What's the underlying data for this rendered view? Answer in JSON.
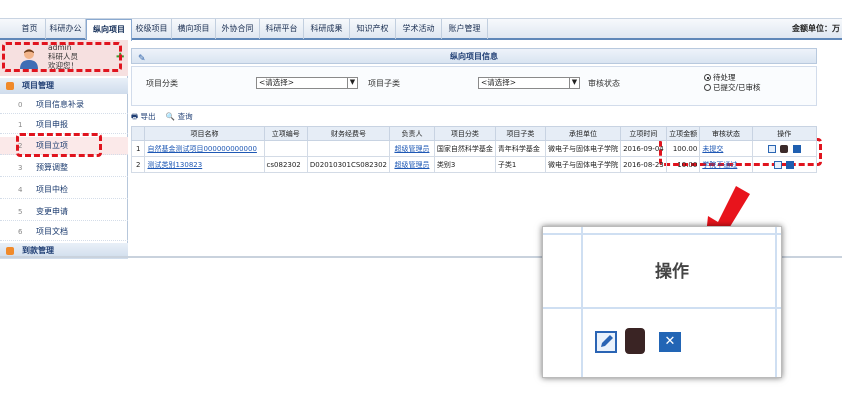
{
  "topnav": {
    "tabs": [
      "首页",
      "科研办公",
      "纵向项目",
      "校级项目",
      "横向项目",
      "外协合同",
      "科研平台",
      "科研成果",
      "知识产权",
      "学术活动",
      "账户管理"
    ],
    "active_index": 2,
    "unit_label": "金额单位：万"
  },
  "user": {
    "name": "admin",
    "role": "科研人员",
    "welcome": "欢迎您！"
  },
  "sidebar": {
    "section1": "项目管理",
    "items": [
      {
        "num": "0",
        "label": "项目信息补录"
      },
      {
        "num": "1",
        "label": "项目申报"
      },
      {
        "num": "2",
        "label": "项目立项"
      },
      {
        "num": "3",
        "label": "预算调整"
      },
      {
        "num": "4",
        "label": "项目中检"
      },
      {
        "num": "5",
        "label": "变更申请"
      },
      {
        "num": "6",
        "label": "项目文档"
      }
    ],
    "section2": "到款管理"
  },
  "panel": {
    "title": "纵向项目信息"
  },
  "filter": {
    "category_label": "项目分类",
    "category_value": "<请选择>",
    "subcategory_label": "项目子类",
    "subcategory_value": "<请选择>",
    "status_label": "审核状态",
    "status_options": [
      "待处理",
      "已提交/已审核"
    ],
    "status_selected": "待处理"
  },
  "toolbar": {
    "export_label": "导出",
    "query_label": "查询"
  },
  "table": {
    "headers": [
      "",
      "项目名称",
      "立项编号",
      "财务经费号",
      "负责人",
      "项目分类",
      "项目子类",
      "承担单位",
      "立项时间",
      "立项金额",
      "审核状态",
      "操作"
    ],
    "rows": [
      {
        "idx": "1",
        "name": "自然基金测试项目000000000000",
        "code": "",
        "finance_no": "",
        "leader": "超级管理员",
        "category": "国家自然科学基金",
        "subcategory": "青年科学基金",
        "unit": "微电子与固体电子学院",
        "date": "2016-09-04",
        "amount": "100.00",
        "status": "未提交"
      },
      {
        "idx": "2",
        "name": "测试类别130823",
        "code": "cs082302",
        "finance_no": "D02010301CS082302",
        "leader": "超级管理员",
        "category": "类别3",
        "subcategory": "子类1",
        "unit": "微电子与固体电子学院",
        "date": "2016-08-23",
        "amount": "10.00",
        "status": "学院不通过"
      }
    ]
  },
  "zoom": {
    "title": "操作"
  },
  "colors": {
    "highlight": "#e0141e",
    "nav_border": "#5f87b8",
    "link": "#1e58b5"
  }
}
